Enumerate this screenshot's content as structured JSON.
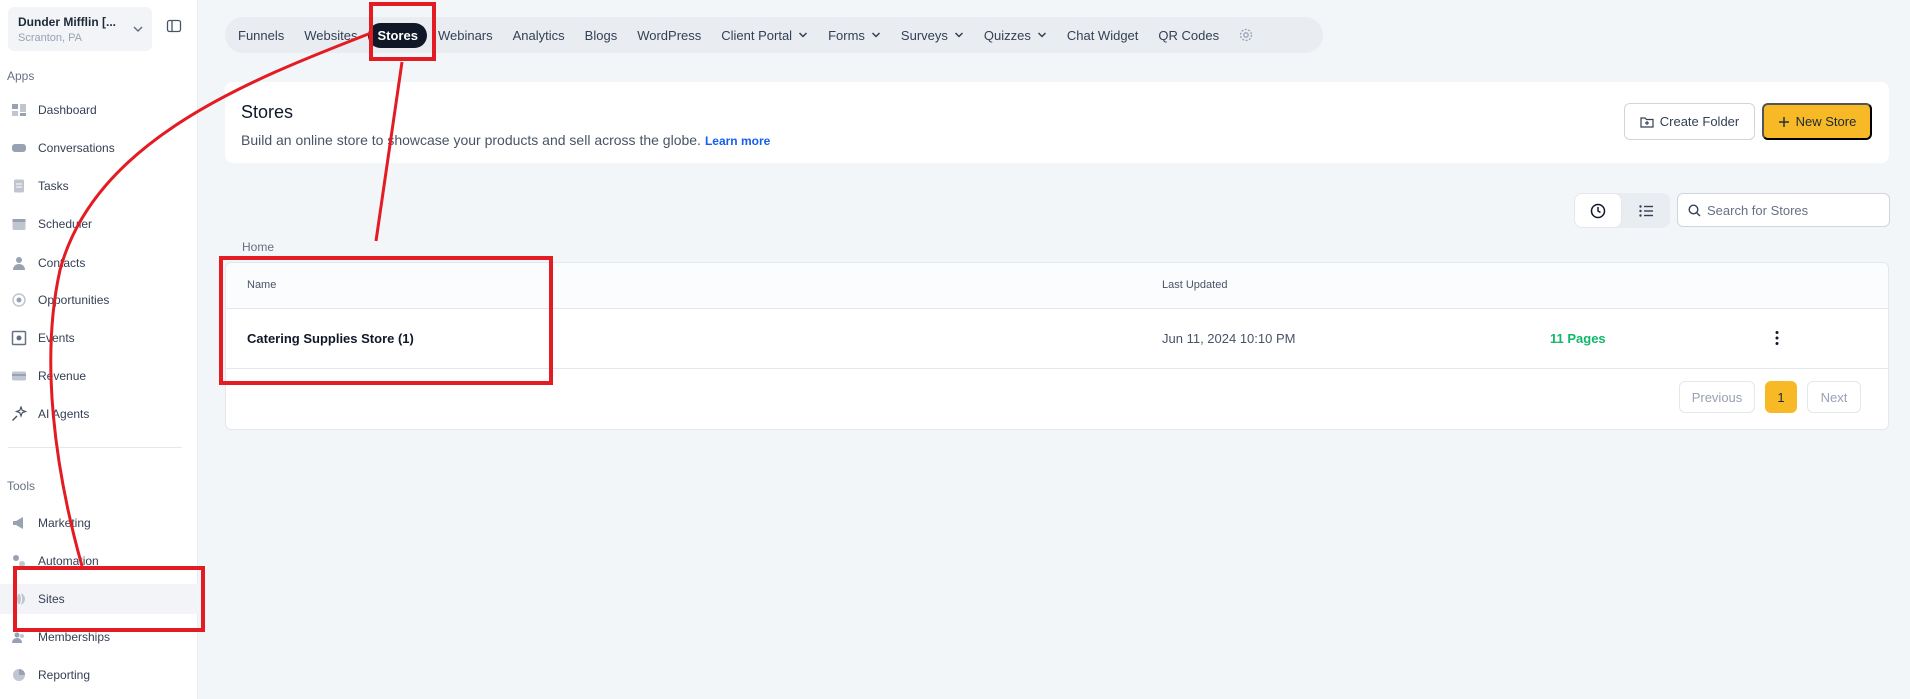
{
  "sidebar": {
    "account_name": "Dunder Mifflin [...",
    "account_location": "Scranton, PA",
    "apps_label": "Apps",
    "tools_label": "Tools",
    "apps": [
      {
        "label": "Dashboard",
        "icon": "dashboard-icon"
      },
      {
        "label": "Conversations",
        "icon": "chat-icon"
      },
      {
        "label": "Tasks",
        "icon": "tasks-icon"
      },
      {
        "label": "Scheduler",
        "icon": "calendar-icon"
      },
      {
        "label": "Contacts",
        "icon": "person-icon"
      },
      {
        "label": "Opportunities",
        "icon": "target-icon"
      },
      {
        "label": "Events",
        "icon": "events-icon"
      },
      {
        "label": "Revenue",
        "icon": "card-icon"
      },
      {
        "label": "AI Agents",
        "icon": "sparkle-icon"
      }
    ],
    "tools": [
      {
        "label": "Marketing",
        "icon": "megaphone-icon"
      },
      {
        "label": "Automation",
        "icon": "automation-icon"
      },
      {
        "label": "Sites",
        "icon": "globe-icon"
      },
      {
        "label": "Memberships",
        "icon": "members-icon"
      },
      {
        "label": "Reporting",
        "icon": "pie-icon"
      }
    ]
  },
  "topnav": {
    "tabs": [
      {
        "label": "Funnels"
      },
      {
        "label": "Websites"
      },
      {
        "label": "Stores",
        "active": true
      },
      {
        "label": "Webinars"
      },
      {
        "label": "Analytics"
      },
      {
        "label": "Blogs"
      },
      {
        "label": "WordPress"
      },
      {
        "label": "Client Portal",
        "dropdown": true
      },
      {
        "label": "Forms",
        "dropdown": true
      },
      {
        "label": "Surveys",
        "dropdown": true
      },
      {
        "label": "Quizzes",
        "dropdown": true
      },
      {
        "label": "Chat Widget"
      },
      {
        "label": "QR Codes"
      }
    ]
  },
  "header": {
    "title": "Stores",
    "subtitle": "Build an online store to showcase your products and sell across the globe.",
    "learn_more": "Learn more",
    "create_folder": "Create Folder",
    "new_store": "New Store"
  },
  "search": {
    "placeholder": "Search for Stores"
  },
  "breadcrumb": "Home",
  "table": {
    "columns": {
      "name": "Name",
      "updated": "Last Updated"
    },
    "rows": [
      {
        "name": "Catering Supplies Store (1)",
        "updated": "Jun 11, 2024 10:10 PM",
        "pages": "11 Pages"
      }
    ]
  },
  "pagination": {
    "previous": "Previous",
    "current": "1",
    "next": "Next"
  },
  "colors": {
    "accent": "#f7b925",
    "active_tab": "#101828",
    "pages_green": "#12b76a",
    "annotation_red": "#e31b23"
  }
}
